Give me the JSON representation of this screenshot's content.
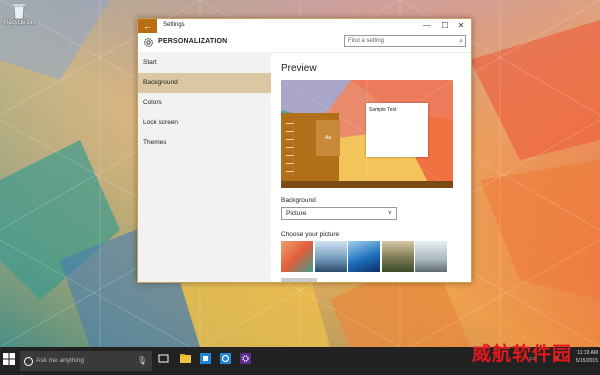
{
  "desktop": {
    "icon_label": "Recycle Bin"
  },
  "window": {
    "title": "Settings",
    "back_icon": "back-arrow-icon",
    "controls": {
      "minimize": "—",
      "maximize": "☐",
      "close": "✕"
    }
  },
  "header": {
    "title": "PERSONALIZATION",
    "search_placeholder": "Find a setting"
  },
  "sidebar": {
    "items": [
      {
        "label": "Start",
        "active": false
      },
      {
        "label": "Background",
        "active": true
      },
      {
        "label": "Colors",
        "active": false
      },
      {
        "label": "Lock screen",
        "active": false
      },
      {
        "label": "Themes",
        "active": false
      }
    ]
  },
  "content": {
    "preview_heading": "Preview",
    "sample_text": "Sample Text",
    "tile_text": "Aa",
    "background_label": "Background",
    "background_value": "Picture",
    "choose_label": "Choose your picture"
  },
  "taskbar": {
    "search_placeholder": "Ask me anything",
    "time": "11:19 AM",
    "date": "5/15/2015"
  },
  "watermark": "威航软件园",
  "colors": {
    "accent": "#b86f14",
    "active_nav": "#dcc7a3",
    "taskbar": "#222222"
  }
}
